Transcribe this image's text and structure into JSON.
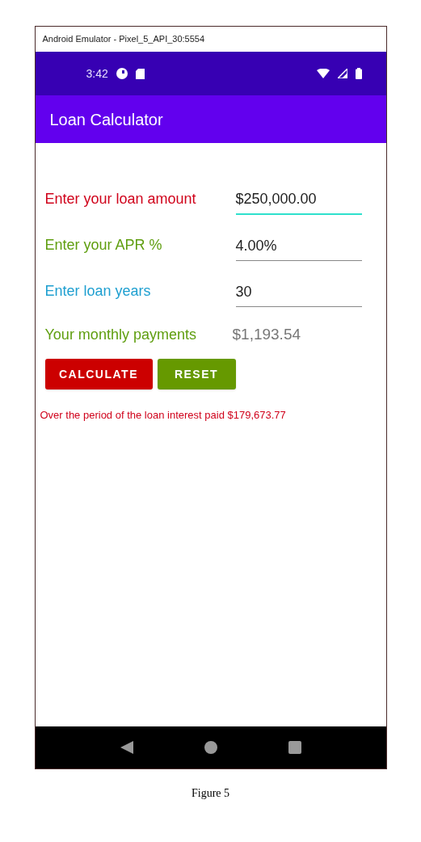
{
  "window": {
    "title": "Android Emulator - Pixel_5_API_30:5554"
  },
  "status_bar": {
    "time": "3:42"
  },
  "app_bar": {
    "title": "Loan Calculator"
  },
  "fields": [
    {
      "label": "Enter your loan amount",
      "color": "#d0021b",
      "value": "$250,000.00",
      "focused": true
    },
    {
      "label": "Enter your APR %",
      "color": "#5f9e0f",
      "value": "4.00%",
      "focused": false
    },
    {
      "label": "Enter loan years",
      "color": "#1e9fd0",
      "value": "30",
      "focused": false
    }
  ],
  "result": {
    "label": "Your monthly payments",
    "color": "#5f9e0f",
    "value": "$1,193.54"
  },
  "buttons": [
    {
      "label": "CALCULATE",
      "color": "#cc0000"
    },
    {
      "label": "RESET",
      "color": "#669900"
    }
  ],
  "message": "Over the period of the loan interest paid $179,673.77",
  "caption": "Figure 5"
}
